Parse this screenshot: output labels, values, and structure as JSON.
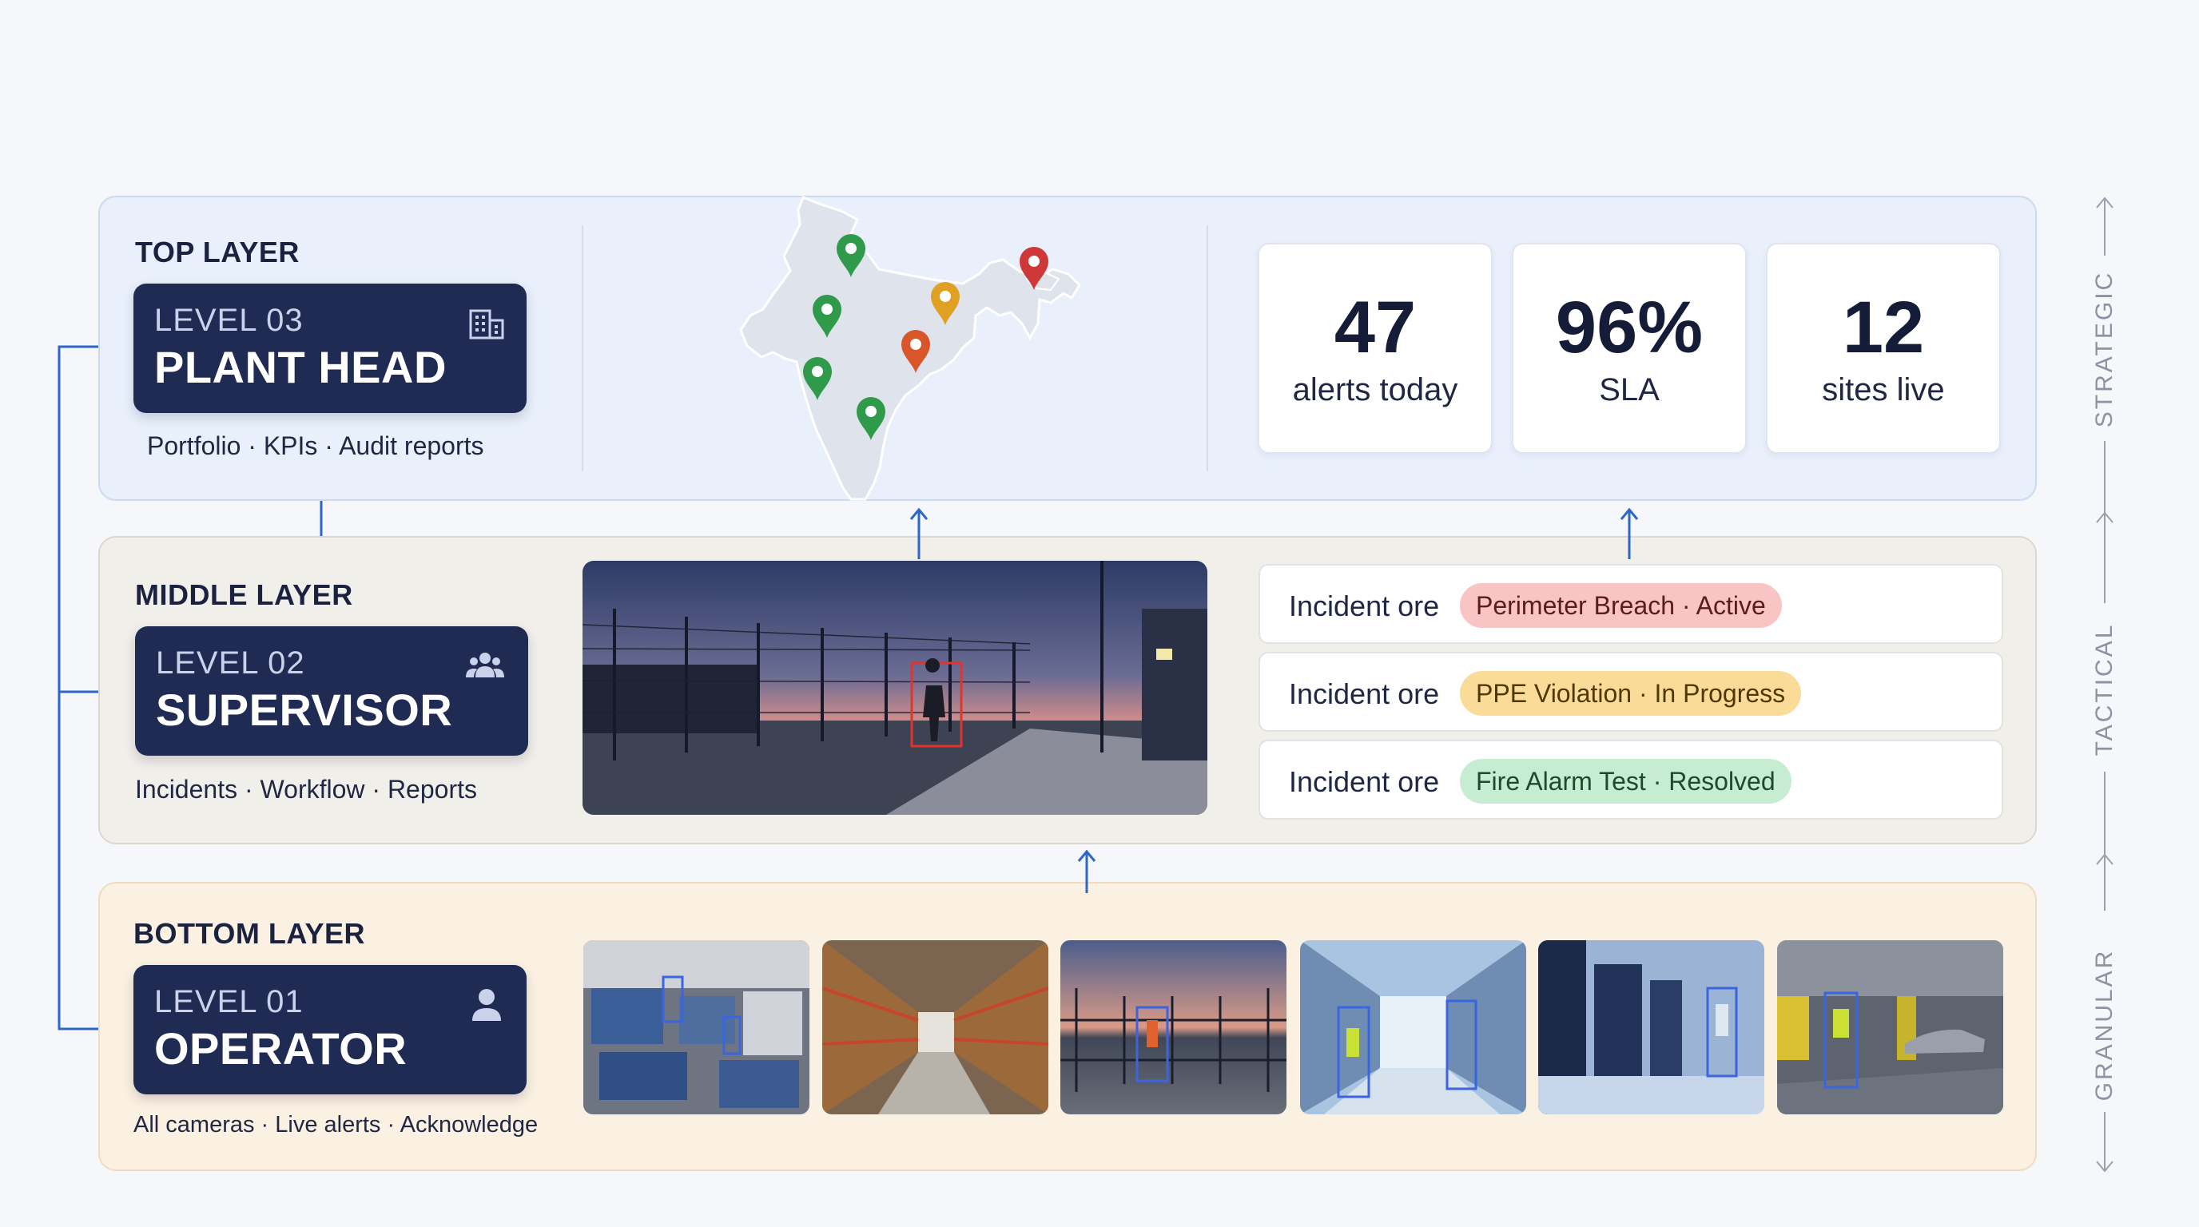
{
  "layers": {
    "top": {
      "title": "TOP LAYER",
      "level": "LEVEL 03",
      "role": "PLANT HEAD",
      "role_icon": "building-icon",
      "description": "Portfolio · KPIs · Audit reports",
      "map": {
        "icon": "india-map",
        "pins": [
          {
            "color": "#2f9a4a"
          },
          {
            "color": "#2f9a4a"
          },
          {
            "color": "#2f9a4a"
          },
          {
            "color": "#2f9a4a"
          },
          {
            "color": "#e0a024"
          },
          {
            "color": "#d9562a"
          },
          {
            "color": "#cf3838"
          }
        ]
      },
      "kpis": [
        {
          "value": "47",
          "label": "alerts today"
        },
        {
          "value": "96%",
          "label": "SLA"
        },
        {
          "value": "12",
          "label": "sites live"
        }
      ]
    },
    "middle": {
      "title": "MIDDLE LAYER",
      "level": "LEVEL 02",
      "role": "SUPERVISOR",
      "role_icon": "users-icon",
      "description": "Incidents · Workflow · Reports",
      "scene": "perimeter-fence-dusk-intruder",
      "incidents": [
        {
          "label": "Incident ore",
          "status": "Perimeter Breach · Active",
          "bg": "#f8c4c4",
          "fg": "#5a1c1c"
        },
        {
          "label": "Incident ore",
          "status": "PPE Violation · In Progress",
          "bg": "#fbdb98",
          "fg": "#4e3806"
        },
        {
          "label": "Incident ore",
          "status": "Fire Alarm Test · Resolved",
          "bg": "#c6ecd2",
          "fg": "#1c4a2a"
        }
      ]
    },
    "bottom": {
      "title": "BOTTOM LAYER",
      "level": "LEVEL 01",
      "role": "OPERATOR",
      "role_icon": "person-icon",
      "description": "All cameras · Live alerts · Acknowledge",
      "cameras": [
        {
          "scene": "factory-floor"
        },
        {
          "scene": "warehouse-aisle"
        },
        {
          "scene": "gate-dusk"
        },
        {
          "scene": "corridor"
        },
        {
          "scene": "server-room"
        },
        {
          "scene": "parking-garage"
        }
      ]
    }
  },
  "scale": [
    "STRATEGIC",
    "TACTICAL",
    "GRANULAR"
  ],
  "colors": {
    "accent": "#2e66c7",
    "card": "#1f2b52"
  }
}
